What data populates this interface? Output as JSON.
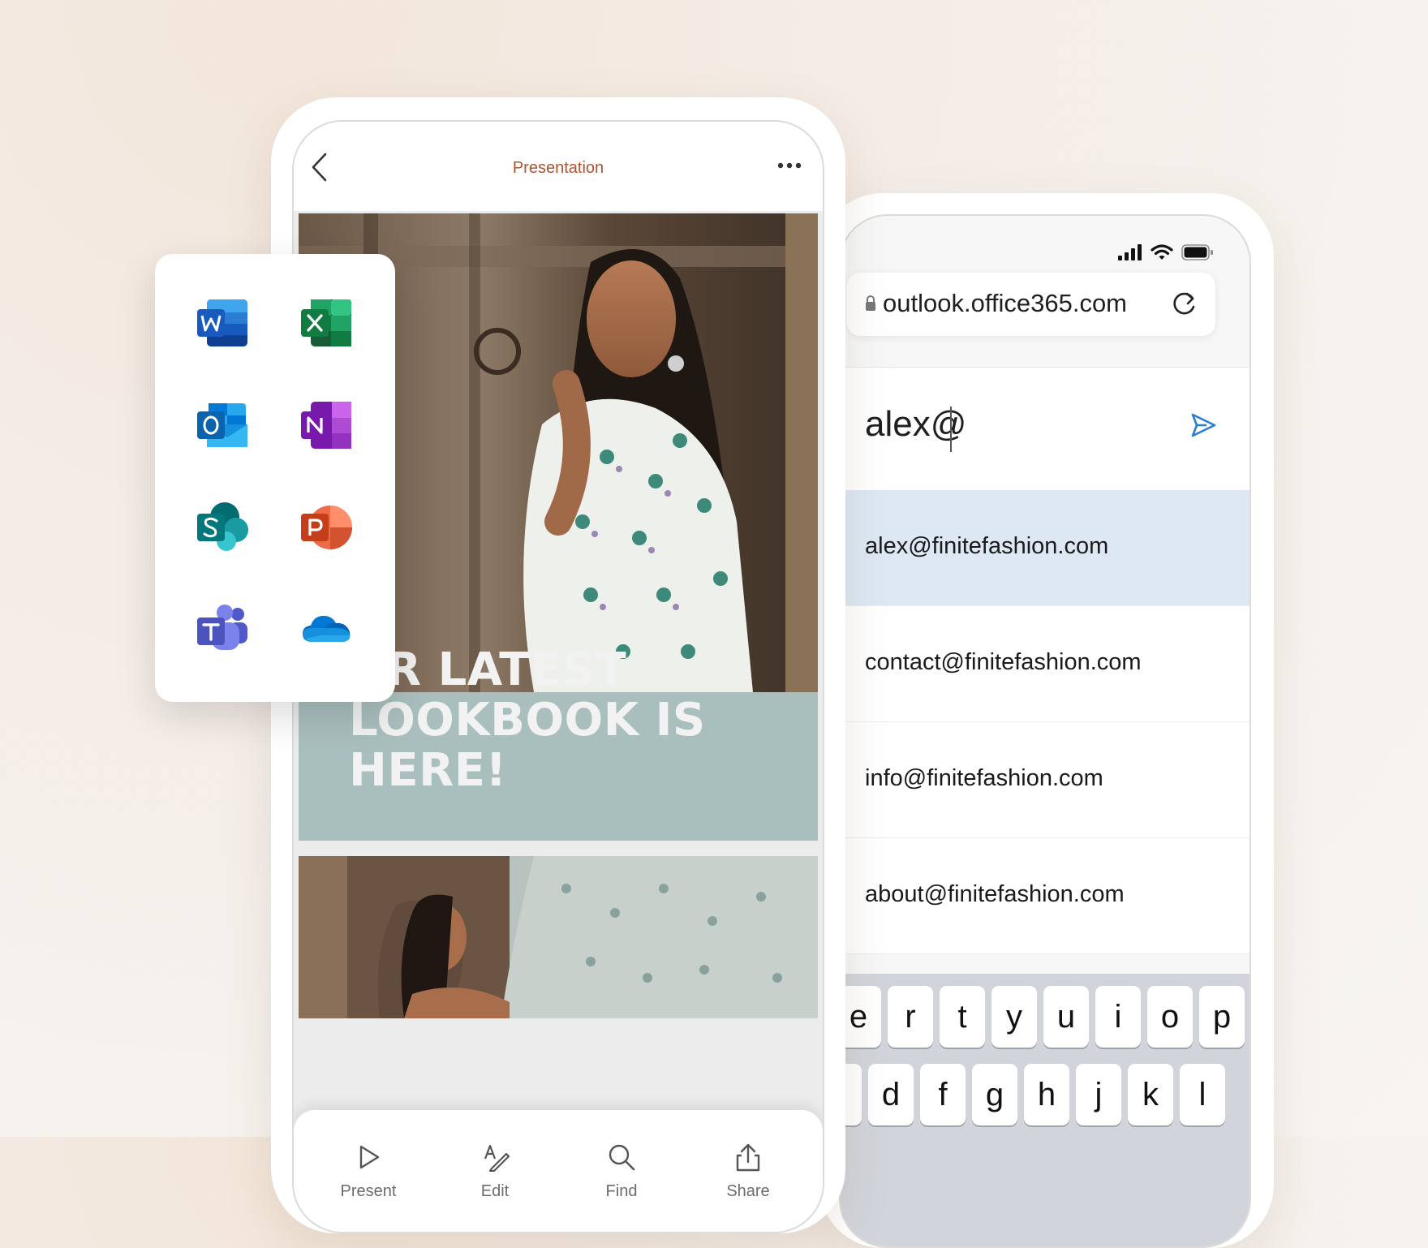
{
  "presentation": {
    "title": "Presentation",
    "slide1": {
      "heading": "UR LATEST LOOKBOOK IS HERE!"
    },
    "toolbar": {
      "present": "Present",
      "edit": "Edit",
      "find": "Find",
      "share": "Share"
    }
  },
  "apps": [
    "Word",
    "Excel",
    "Outlook",
    "OneNote",
    "SharePoint",
    "PowerPoint",
    "Teams",
    "OneDrive"
  ],
  "browser": {
    "url": "outlook.office365.com",
    "compose_value": "alex@",
    "suggestions": [
      "alex@finitefashion.com",
      "contact@finitefashion.com",
      "info@finitefashion.com",
      "about@finitefashion.com"
    ]
  },
  "keyboard": {
    "row1": [
      "e",
      "r",
      "t",
      "y",
      "u",
      "i",
      "o",
      "p"
    ],
    "row2": [
      "d",
      "f",
      "g",
      "h",
      "j",
      "k",
      "l"
    ]
  },
  "colors": {
    "title_accent": "#b0532f",
    "selected_suggestion": "#dde8f4",
    "send_blue": "#2b7cd3",
    "slide_band": "#a9bfbe"
  }
}
